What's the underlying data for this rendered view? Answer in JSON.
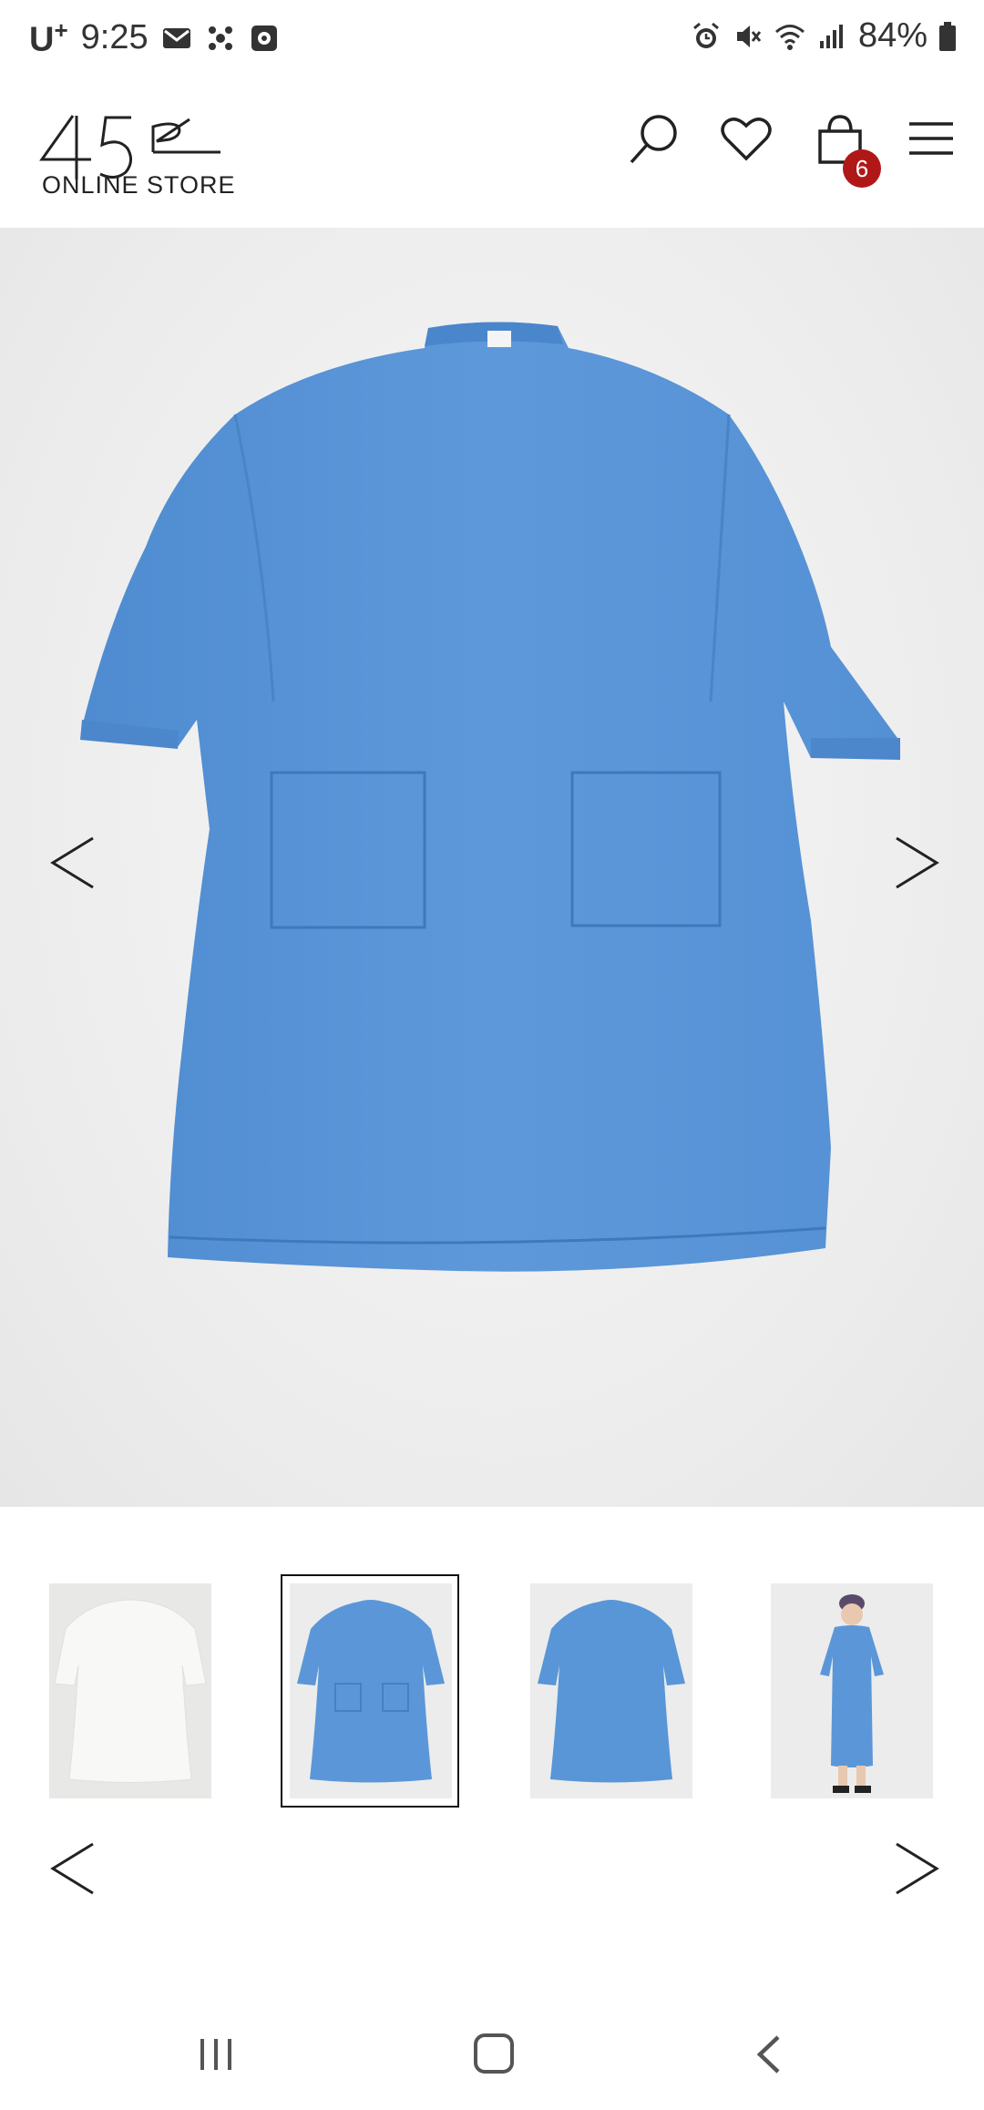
{
  "status_bar": {
    "carrier": "U",
    "carrier_suffix": "+",
    "time": "9:25",
    "battery": "84%",
    "left_icons": [
      "mail-icon",
      "network-icon",
      "screen-record-icon"
    ],
    "right_icons": [
      "alarm-icon",
      "mute-icon",
      "wifi-icon",
      "signal-icon",
      "battery-icon"
    ]
  },
  "header": {
    "logo_text": "45R",
    "logo_subtitle": "ONLINE STORE",
    "cart_count": "6",
    "icons": [
      "search-icon",
      "heart-icon",
      "bag-icon",
      "menu-icon"
    ]
  },
  "gallery": {
    "main_image_color": "#5b97d8",
    "thumbnails": [
      {
        "name": "white-dress-thumb",
        "color": "#f3f3f1"
      },
      {
        "name": "blue-dress-front-thumb",
        "color": "#5b97d8",
        "selected": true
      },
      {
        "name": "blue-dress-back-thumb",
        "color": "#5b97d8"
      },
      {
        "name": "model-wearing-thumb",
        "color": "#5b97d8"
      }
    ]
  },
  "colors": {
    "badge": "#b01818",
    "dress_blue": "#5b97d8"
  }
}
